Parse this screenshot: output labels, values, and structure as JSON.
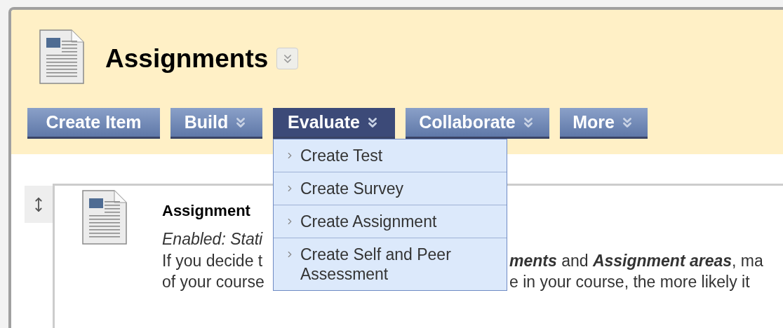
{
  "page": {
    "title": "Assignments"
  },
  "toolbar": [
    {
      "label": "Create Item",
      "has_menu": false,
      "selected": false
    },
    {
      "label": "Build",
      "has_menu": true,
      "selected": false
    },
    {
      "label": "Evaluate",
      "has_menu": true,
      "selected": true
    },
    {
      "label": "Collaborate",
      "has_menu": true,
      "selected": false
    },
    {
      "label": "More",
      "has_menu": true,
      "selected": false
    }
  ],
  "menu": {
    "items": [
      {
        "label": "Create Test"
      },
      {
        "label": "Create Survey"
      },
      {
        "label": "Create Assignment"
      },
      {
        "label": "Create Self and Peer Assessment"
      }
    ]
  },
  "content_item": {
    "title": "Assignment",
    "status": "Enabled: Stati",
    "lines": [
      {
        "left": "If you decide t",
        "right": "**ments** and **Assignment areas**, ma"
      },
      {
        "left": "of your course",
        "right": "e in your course, the more likely it"
      }
    ]
  }
}
